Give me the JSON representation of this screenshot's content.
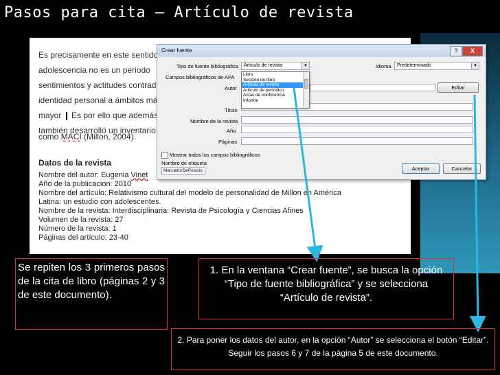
{
  "slide": {
    "title": "Pasos para cita – Artículo de revista"
  },
  "document": {
    "paragraph_lines": [
      "Es precisamente en este sentido",
      "adolescencia no es un periodo",
      "sentimientos y actitudes contradi",
      "identidad personal a ámbitos más",
      "mayor",
      "Es por ello que además c",
      "también desarrolló un inventario",
      "como",
      "MACI",
      "(Millon, 2004)."
    ],
    "section_heading": "Datos de la revista",
    "data_lines": [
      "Nombre del autor: Eugenia",
      "Vinet",
      "Año de la publicación: 2010",
      "Nombre del artículo: Relativismo cultural del modelo de personalidad de Millon en América",
      "Latina: un estudio con adolescentes.",
      "Nombre de la revista: Interdisciplinaria: Revista de Psicología y Ciencias Afines",
      "Volumen de la revista: 27",
      "Número de la revista: 1",
      "Páginas del artículo: 23-40"
    ]
  },
  "dialog": {
    "title": "Crear fuente",
    "help": "?",
    "close": "X",
    "source_type_label": "Tipo de fuente bibliográfica",
    "source_type_value": "Artículo de revista",
    "language_label": "Idioma",
    "language_value": "Predeterminado",
    "apa_fields_label": "Campos bibliográficos de APA",
    "dropdown_items": [
      "Libro",
      "Sección de libro",
      "Artículo de revista",
      "Artículo de periódico",
      "Actas de conferencia",
      "Informe"
    ],
    "selected_item": "Artículo de revista",
    "field_labels": {
      "autor": "Autor",
      "titulo": "Título",
      "revista": "Nombre de la revista",
      "anio": "Año",
      "paginas": "Páginas"
    },
    "edit_button": "Editar",
    "show_all_label": "Mostrar todos los campos bibliográficos",
    "tag_name_label": "Nombre de etiqueta",
    "tag_name_value": "MarcadorDePosicio",
    "accept_button": "Aceptar",
    "cancel_button": "Cancelar"
  },
  "callouts": {
    "left": "Se repiten los 3 primeros pasos de la cita de libro (páginas 2 y 3 de este documento).",
    "center": "1. En la ventana “Crear fuente”, se busca la opción “Tipo de fuente bibliográfica” y se selecciona “Artículo de revista”.",
    "bottom": "2. Para poner los datos del autor, en la opción “Autor” se selecciona el botón “Editar”. Seguir los pasos 6 y 7 de la página 5 de este documento."
  },
  "colors": {
    "background": "#000000",
    "callout_border": "#e03030",
    "arrow": "#2fb6e0",
    "selection": "#3399ff"
  }
}
